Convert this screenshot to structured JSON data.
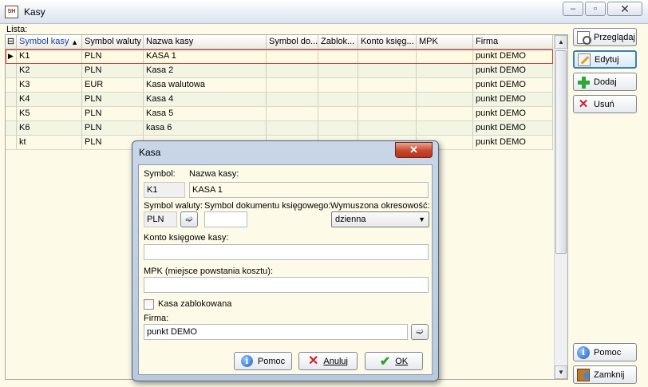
{
  "window": {
    "title": "Kasy",
    "app_icon_text": "SH",
    "minimize": "‒",
    "maximize": "▫",
    "close": "✕"
  },
  "lista_label": "Lista:",
  "table": {
    "columns": [
      "Symbol kasy",
      "Symbol waluty",
      "Nazwa kasy",
      "Symbol do...",
      "Zablok...",
      "Konto księg...",
      "MPK",
      "Firma"
    ],
    "rows": [
      {
        "symbol": "K1",
        "waluta": "PLN",
        "nazwa": "KASA 1",
        "symbol_dok": "",
        "zablok": "",
        "konto": "",
        "mpk": "",
        "firma": "punkt DEMO"
      },
      {
        "symbol": "K2",
        "waluta": "PLN",
        "nazwa": "Kasa 2",
        "symbol_dok": "",
        "zablok": "",
        "konto": "",
        "mpk": "",
        "firma": "punkt DEMO"
      },
      {
        "symbol": "K3",
        "waluta": "EUR",
        "nazwa": "Kasa walutowa",
        "symbol_dok": "",
        "zablok": "",
        "konto": "",
        "mpk": "",
        "firma": "punkt DEMO"
      },
      {
        "symbol": "K4",
        "waluta": "PLN",
        "nazwa": "Kasa 4",
        "symbol_dok": "",
        "zablok": "",
        "konto": "",
        "mpk": "",
        "firma": "punkt DEMO"
      },
      {
        "symbol": "K5",
        "waluta": "PLN",
        "nazwa": "Kasa 5",
        "symbol_dok": "",
        "zablok": "",
        "konto": "",
        "mpk": "",
        "firma": "punkt DEMO"
      },
      {
        "symbol": "K6",
        "waluta": "PLN",
        "nazwa": "kasa 6",
        "symbol_dok": "",
        "zablok": "",
        "konto": "",
        "mpk": "",
        "firma": "punkt DEMO"
      },
      {
        "symbol": "kt",
        "waluta": "PLN",
        "nazwa": "",
        "symbol_dok": "",
        "zablok": "",
        "konto": "",
        "mpk": "",
        "firma": "punkt DEMO"
      }
    ]
  },
  "side_buttons": {
    "przegladaj": "Przeglądaj",
    "edytuj": "Edytuj",
    "dodaj": "Dodaj",
    "usun": "Usuń",
    "pomoc": "Pomoc",
    "zamknij": "Zamknij"
  },
  "dialog": {
    "title": "Kasa",
    "close": "✕",
    "symbol_label": "Symbol:",
    "symbol_value": "K1",
    "nazwa_label": "Nazwa kasy:",
    "nazwa_value": "KASA 1",
    "waluta_label": "Symbol waluty:",
    "waluta_value": "PLN",
    "symbol_dok_label": "Symbol dokumentu księgowego:",
    "symbol_dok_value": "",
    "okresowosc_label": "Wymuszona okresowość:",
    "okresowosc_value": "dzienna",
    "konto_label": "Konto księgowe kasy:",
    "konto_value": "",
    "mpk_label": "MPK (miejsce powstania kosztu):",
    "mpk_value": "",
    "zablokowana_label": "Kasa zablokowana",
    "firma_label": "Firma:",
    "firma_value": "punkt DEMO",
    "pomoc": "Pomoc",
    "anuluj": "Anuluj",
    "ok": "OK"
  },
  "colors": {
    "background": "#fdfbe8",
    "selected_outline": "#c43a3a",
    "sorted_header": "#1a44b8",
    "active_button": "#3c7fb1"
  }
}
